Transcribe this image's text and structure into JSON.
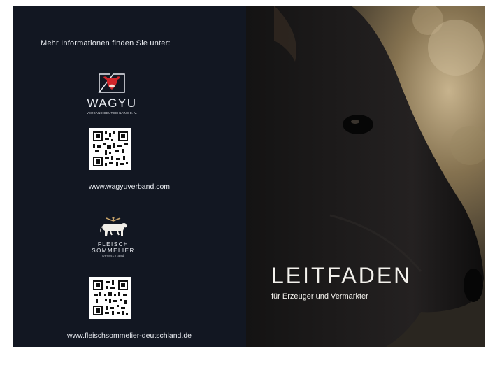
{
  "left_panel": {
    "intro": "Mehr Informationen finden Sie unter:",
    "wagyu_logo": {
      "name": "WAGYU",
      "subtitle": "VERBAND DEUTSCHLAND E. V.",
      "icon": "bull-head-icon"
    },
    "url_wagyu": "www.wagyuverband.com",
    "fleischsommelier_logo": {
      "line1": "FLEISCH",
      "line2": "SOMMELIER",
      "line3": "Deutschland",
      "icon": "cow-icon"
    },
    "url_fleisch": "www.fleischsommelier-deutschland.de"
  },
  "right_panel": {
    "title": "LEITFADEN",
    "subtitle": "für Erzeuger und Vermarkter",
    "image": "black-cow-head-profile"
  },
  "colors": {
    "panel_dark": "#121722",
    "wagyu_red": "#d0262b",
    "text_light": "#e9ecf1"
  }
}
